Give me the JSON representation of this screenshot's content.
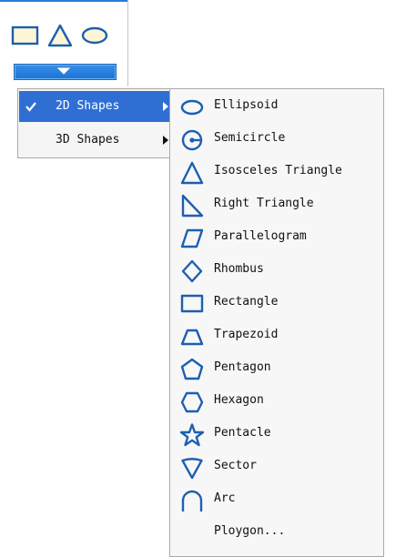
{
  "colors": {
    "accent": "#2f6fd4",
    "icon": "#1d5fb0"
  },
  "toolbar": {
    "icons": [
      "rectangle-icon",
      "triangle-icon",
      "ellipse-icon"
    ],
    "dropdown_icon": "chevron-down-icon"
  },
  "menu": {
    "items": [
      {
        "label": "2D Shapes",
        "checked": true,
        "has_submenu": true
      },
      {
        "label": "3D Shapes",
        "checked": false,
        "has_submenu": true
      }
    ]
  },
  "submenu": {
    "items": [
      {
        "label": "Ellipsoid",
        "icon": "ellipse-icon"
      },
      {
        "label": "Semicircle",
        "icon": "semicircle-icon"
      },
      {
        "label": "Isosceles Triangle",
        "icon": "isosceles-triangle-icon"
      },
      {
        "label": "Right Triangle",
        "icon": "right-triangle-icon"
      },
      {
        "label": "Parallelogram",
        "icon": "parallelogram-icon"
      },
      {
        "label": "Rhombus",
        "icon": "rhombus-icon"
      },
      {
        "label": "Rectangle",
        "icon": "rectangle-icon"
      },
      {
        "label": "Trapezoid",
        "icon": "trapezoid-icon"
      },
      {
        "label": "Pentagon",
        "icon": "pentagon-icon"
      },
      {
        "label": "Hexagon",
        "icon": "hexagon-icon"
      },
      {
        "label": "Pentacle",
        "icon": "star-icon"
      },
      {
        "label": "Sector",
        "icon": "sector-icon"
      },
      {
        "label": "Arc",
        "icon": "arc-icon"
      },
      {
        "label": "Ploygon...",
        "icon": ""
      }
    ]
  }
}
